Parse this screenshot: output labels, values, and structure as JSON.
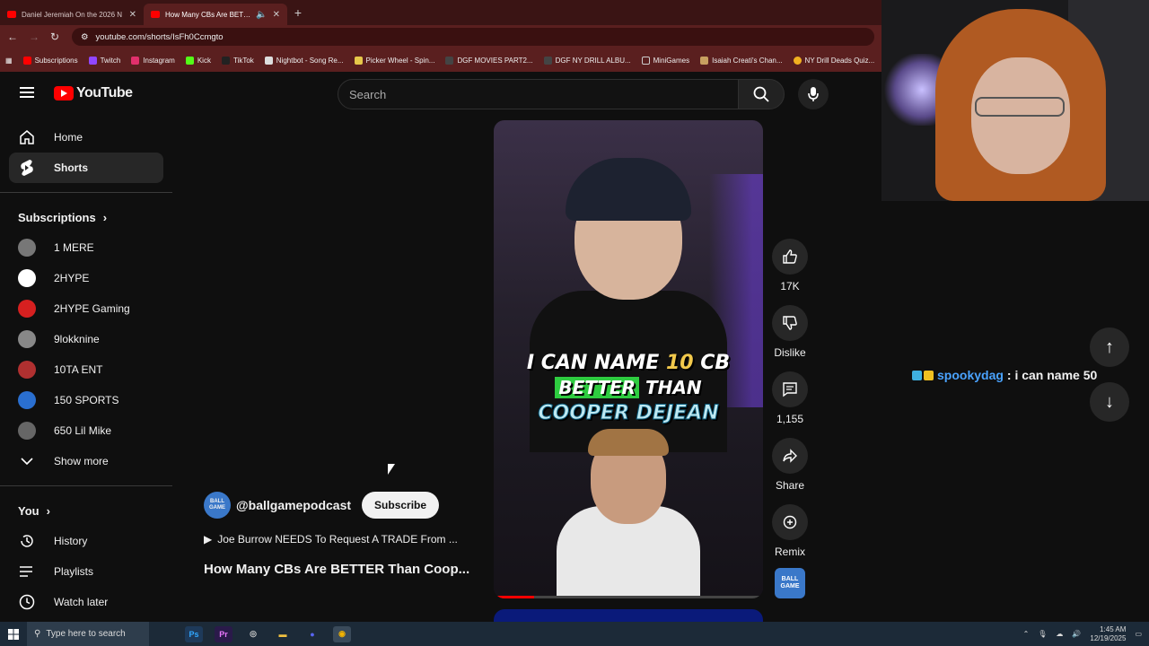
{
  "browser": {
    "tabs": [
      {
        "title": "Daniel Jeremiah On the 2026 N",
        "active": false
      },
      {
        "title": "How Many CBs Are BETTER",
        "active": true
      }
    ],
    "new_tab": "+",
    "url": "youtube.com/shorts/IsFh0Ccmgto",
    "bookmarks": [
      "Subscriptions",
      "Twitch",
      "Instagram",
      "Kick",
      "TikTok",
      "Nightbot - Song Re...",
      "Picker Wheel - Spin...",
      "DGF MOVIES PART2...",
      "DGF NY DRILL ALBU...",
      "MiniGames",
      "Isaiah Creati's Chan...",
      "NY Drill Deads Quiz..."
    ]
  },
  "youtube": {
    "logo_text": "YouTube",
    "search_placeholder": "Search",
    "sidebar": {
      "main": [
        {
          "label": "Home",
          "icon": "home-icon",
          "active": false
        },
        {
          "label": "Shorts",
          "icon": "shorts-icon",
          "active": true
        }
      ],
      "subscriptions_header": "Subscriptions",
      "subscriptions": [
        {
          "label": "1 MERE",
          "color": "#777777"
        },
        {
          "label": "2HYPE",
          "color": "#ffffff"
        },
        {
          "label": "2HYPE Gaming",
          "color": "#d62020"
        },
        {
          "label": "9lokknine",
          "color": "#888888"
        },
        {
          "label": "10TA ENT",
          "color": "#b03030"
        },
        {
          "label": "150 SPORTS",
          "color": "#2a6fd0"
        },
        {
          "label": "650 Lil Mike",
          "color": "#666666"
        }
      ],
      "show_more": "Show more",
      "you_header": "You",
      "you": [
        {
          "label": "History",
          "icon": "history-icon"
        },
        {
          "label": "Playlists",
          "icon": "playlists-icon"
        },
        {
          "label": "Watch later",
          "icon": "watch-later-icon"
        }
      ]
    },
    "short": {
      "caption_line1_a": "I CAN NAME ",
      "caption_line1_num": "10",
      "caption_line1_b": " CB",
      "caption_line2": "BETTER",
      "caption_line2_b": " THAN",
      "caption_line3": "COOPER DEJEAN",
      "progress": 0.15
    },
    "actions": {
      "likes": "17K",
      "dislike": "Dislike",
      "comments": "1,155",
      "share": "Share",
      "remix": "Remix"
    },
    "channel": {
      "handle": "@ballgamepodcast",
      "avatar_text": "BALL GAME",
      "subscribe": "Subscribe"
    },
    "related_video": "Joe Burrow NEEDS To Request A TRADE From ...",
    "video_title": "How Many CBs Are BETTER Than Coop..."
  },
  "overlay": {
    "chat_user": "spookydag",
    "chat_message": ": i can name 50"
  },
  "taskbar": {
    "search_placeholder": "Type here to search",
    "time": "1:45 AM",
    "date": "12/19/2025"
  },
  "colors": {
    "accent": "#ff0000",
    "chrome_theme": "#5a1f1f",
    "chat_name": "#4aa3ff"
  }
}
